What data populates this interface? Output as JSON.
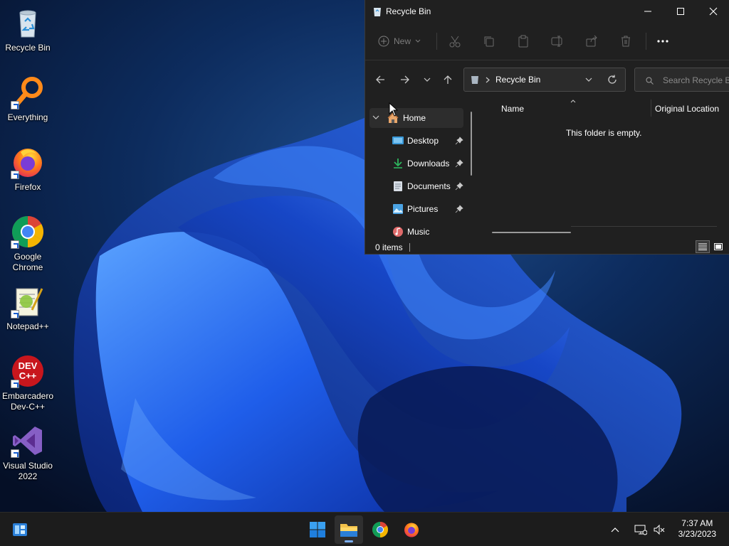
{
  "desktop": {
    "icons": [
      {
        "label": "Recycle Bin",
        "icon": "recycle-bin-icon"
      },
      {
        "label": "Everything",
        "icon": "everything-search-icon"
      },
      {
        "label": "Firefox",
        "icon": "firefox-icon"
      },
      {
        "label": "Google Chrome",
        "icon": "chrome-icon"
      },
      {
        "label": "Notepad++",
        "icon": "notepad-plus-plus-icon"
      },
      {
        "label": "Embarcadero Dev-C++",
        "icon": "devcpp-icon"
      },
      {
        "label": "Visual Studio 2022",
        "icon": "visual-studio-icon"
      }
    ]
  },
  "explorer": {
    "title": "Recycle Bin",
    "toolbar": {
      "new_label": "New"
    },
    "address": {
      "path": "Recycle Bin"
    },
    "search": {
      "placeholder": "Search Recycle Bin"
    },
    "nav": {
      "items": [
        {
          "label": "Home",
          "icon": "home-icon",
          "pinned": false
        },
        {
          "label": "Desktop",
          "icon": "desktop-folder-icon",
          "pinned": true
        },
        {
          "label": "Downloads",
          "icon": "downloads-folder-icon",
          "pinned": true
        },
        {
          "label": "Documents",
          "icon": "documents-folder-icon",
          "pinned": true
        },
        {
          "label": "Pictures",
          "icon": "pictures-folder-icon",
          "pinned": true
        },
        {
          "label": "Music",
          "icon": "music-folder-icon",
          "pinned": false
        }
      ]
    },
    "columns": [
      "Name",
      "Original Location"
    ],
    "empty_message": "This folder is empty.",
    "status": {
      "item_count": "0 items"
    }
  },
  "taskbar": {
    "apps": [
      "widgets",
      "start",
      "file-explorer",
      "chrome",
      "firefox"
    ],
    "clock": {
      "time": "7:37 AM",
      "date": "3/23/2023"
    }
  },
  "colors": {
    "accent": "#0078d4",
    "window_bg": "#202020",
    "taskbar_bg": "#1c1c1c"
  }
}
